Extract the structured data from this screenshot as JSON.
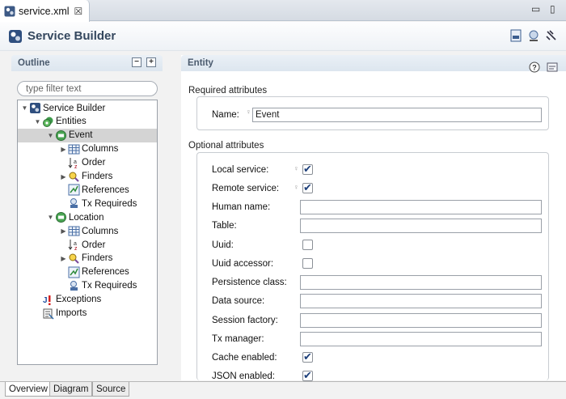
{
  "editor_tab": {
    "title": "service.xml",
    "close": "☒"
  },
  "window_controls": {
    "minimize": "▭",
    "maximize": "▯"
  },
  "header": {
    "title": "Service Builder"
  },
  "outline": {
    "title": "Outline",
    "filter_placeholder": "type filter text",
    "tree": [
      {
        "label": "Service Builder",
        "depth": 0,
        "toggle": "▼",
        "icon": "service-builder-icon"
      },
      {
        "label": "Entities",
        "depth": 1,
        "toggle": "▼",
        "icon": "entities-icon"
      },
      {
        "label": "Event",
        "depth": 2,
        "toggle": "▼",
        "icon": "entity-icon",
        "selected": true
      },
      {
        "label": "Columns",
        "depth": 3,
        "toggle": "▶",
        "icon": "columns-icon"
      },
      {
        "label": "Order",
        "depth": 3,
        "toggle": "",
        "icon": "order-icon"
      },
      {
        "label": "Finders",
        "depth": 3,
        "toggle": "▶",
        "icon": "finders-icon"
      },
      {
        "label": "References",
        "depth": 3,
        "toggle": "",
        "icon": "references-icon"
      },
      {
        "label": "Tx Requireds",
        "depth": 3,
        "toggle": "",
        "icon": "tx-requireds-icon"
      },
      {
        "label": "Location",
        "depth": 2,
        "toggle": "▼",
        "icon": "entity-icon"
      },
      {
        "label": "Columns",
        "depth": 3,
        "toggle": "▶",
        "icon": "columns-icon"
      },
      {
        "label": "Order",
        "depth": 3,
        "toggle": "",
        "icon": "order-icon"
      },
      {
        "label": "Finders",
        "depth": 3,
        "toggle": "▶",
        "icon": "finders-icon"
      },
      {
        "label": "References",
        "depth": 3,
        "toggle": "",
        "icon": "references-icon"
      },
      {
        "label": "Tx Requireds",
        "depth": 3,
        "toggle": "",
        "icon": "tx-requireds-icon"
      },
      {
        "label": "Exceptions",
        "depth": 1,
        "toggle": "",
        "icon": "exceptions-icon"
      },
      {
        "label": "Imports",
        "depth": 1,
        "toggle": "",
        "icon": "imports-icon"
      }
    ]
  },
  "entity": {
    "title": "Entity",
    "required": {
      "title": "Required attributes",
      "name_label": "Name:",
      "name_value": "Event"
    },
    "optional": {
      "title": "Optional attributes",
      "fields": [
        {
          "label": "Local service:",
          "kind": "check",
          "checked": true,
          "bulb": true
        },
        {
          "label": "Remote service:",
          "kind": "check",
          "checked": true,
          "bulb": true
        },
        {
          "label": "Human name:",
          "kind": "text",
          "value": ""
        },
        {
          "label": "Table:",
          "kind": "text",
          "value": ""
        },
        {
          "label": "Uuid:",
          "kind": "check",
          "checked": false
        },
        {
          "label": "Uuid accessor:",
          "kind": "check",
          "checked": false
        },
        {
          "label": "Persistence class:",
          "kind": "text",
          "value": ""
        },
        {
          "label": "Data source:",
          "kind": "text",
          "value": ""
        },
        {
          "label": "Session factory:",
          "kind": "text",
          "value": ""
        },
        {
          "label": "Tx manager:",
          "kind": "text",
          "value": ""
        },
        {
          "label": "Cache enabled:",
          "kind": "check",
          "checked": true
        },
        {
          "label": "JSON enabled:",
          "kind": "check",
          "checked": true
        }
      ]
    }
  },
  "bottom_tabs": [
    {
      "label": "Overview",
      "active": true
    },
    {
      "label": "Diagram",
      "active": false
    },
    {
      "label": "Source",
      "active": false
    }
  ]
}
